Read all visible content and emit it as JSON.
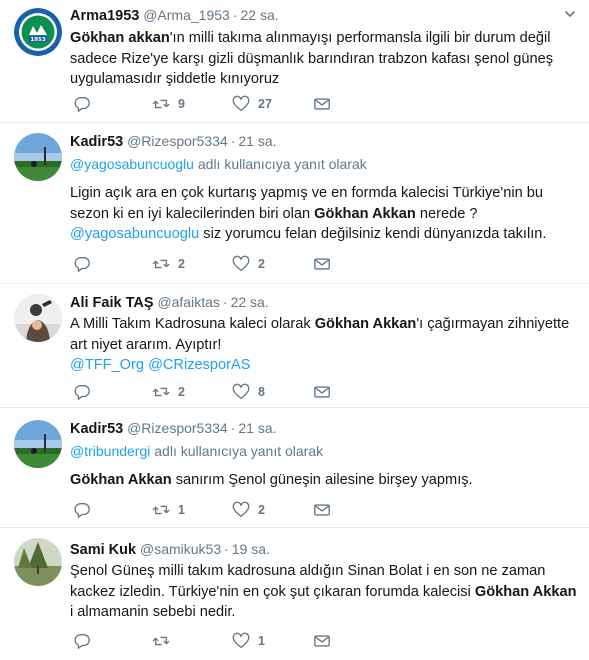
{
  "tweets": [
    {
      "name": "Arma1953",
      "handle": "@Arma_1953",
      "time": "22 sa.",
      "reply_to_prefix": "",
      "reply_to_suffix": "",
      "text_parts": [
        {
          "t": "Gökhan akkan",
          "b": true
        },
        {
          "t": "'ın milli takıma alınmayışı performansla ilgili bir durum değil sadece Rize'ye karşı gizli düşmanlık barındıran trabzon kafası şenol güneş uygulamasıdır şiddetle kınıyoruz"
        }
      ],
      "replies": "",
      "retweets": "9",
      "likes": "27"
    },
    {
      "name": "Kadir53",
      "handle": "@Rizespor5334",
      "time": "21 sa.",
      "reply_to_prefix": "@yagosabuncuoglu",
      "reply_to_suffix": " adlı kullanıcıya yanıt olarak",
      "text_parts": [
        {
          "t": "Ligin açık ara en çok kurtarış yapmış ve en formda kalecisi Türkiye'nin bu sezon ki en iyi kalecilerinden biri olan "
        },
        {
          "t": "Gökhan Akkan",
          "b": true
        },
        {
          "t": " nerede ? "
        },
        {
          "t": "@yagosabuncuoglu",
          "m": true
        },
        {
          "t": "  siz yorumcu felan değilsiniz kendi dünyanızda takılın."
        }
      ],
      "replies": "",
      "retweets": "2",
      "likes": "2"
    },
    {
      "name": "Ali Faik TAŞ",
      "handle": "@afaiktas",
      "time": "22 sa.",
      "reply_to_prefix": "",
      "reply_to_suffix": "",
      "text_parts": [
        {
          "t": "A Milli Takım Kadrosuna kaleci olarak "
        },
        {
          "t": "Gökhan Akkan",
          "b": true
        },
        {
          "t": "'ı çağırmayan zihniyette art niyet ararım. Ayıptır! "
        },
        {
          "t": "@TFF_Org",
          "m": true,
          "br": true
        },
        {
          "t": " "
        },
        {
          "t": "@CRizesporAS",
          "m": true
        }
      ],
      "replies": "",
      "retweets": "2",
      "likes": "8"
    },
    {
      "name": "Kadir53",
      "handle": "@Rizespor5334",
      "time": "21 sa.",
      "reply_to_prefix": "@tribundergi",
      "reply_to_suffix": " adlı kullanıcıya yanıt olarak",
      "text_parts": [
        {
          "t": "Gökhan Akkan",
          "b": true
        },
        {
          "t": " sanırım Şenol güneşin ailesine birşey yapmış."
        }
      ],
      "replies": "",
      "retweets": "1",
      "likes": "2"
    },
    {
      "name": "Sami Kuk",
      "handle": "@samikuk53",
      "time": "19 sa.",
      "reply_to_prefix": "",
      "reply_to_suffix": "",
      "text_parts": [
        {
          "t": "Şenol Güneş milli takım kadrosuna aldığın Sinan Bolat i en son ne zaman kackez izledin. Türkiye'nin en çok şut çıkaran forumda kalecisi "
        },
        {
          "t": "Gökhan Akkan",
          "b": true
        },
        {
          "t": " i almamanin sebebi nedir."
        }
      ],
      "replies": "",
      "retweets": "",
      "likes": "1"
    }
  ],
  "avatar_badge": {
    "text": "RİZE SPOR KULÜBÜ",
    "year": "1953"
  },
  "colors": {
    "text": "#14171a",
    "muted": "#657786",
    "link": "#1da1f2",
    "divider": "#e6ecf0",
    "rize_blue": "#1b5fa4",
    "rize_green": "#0d8f4f"
  },
  "icons": [
    "reply-icon",
    "retweet-icon",
    "like-icon",
    "message-icon",
    "caret-down-icon"
  ]
}
